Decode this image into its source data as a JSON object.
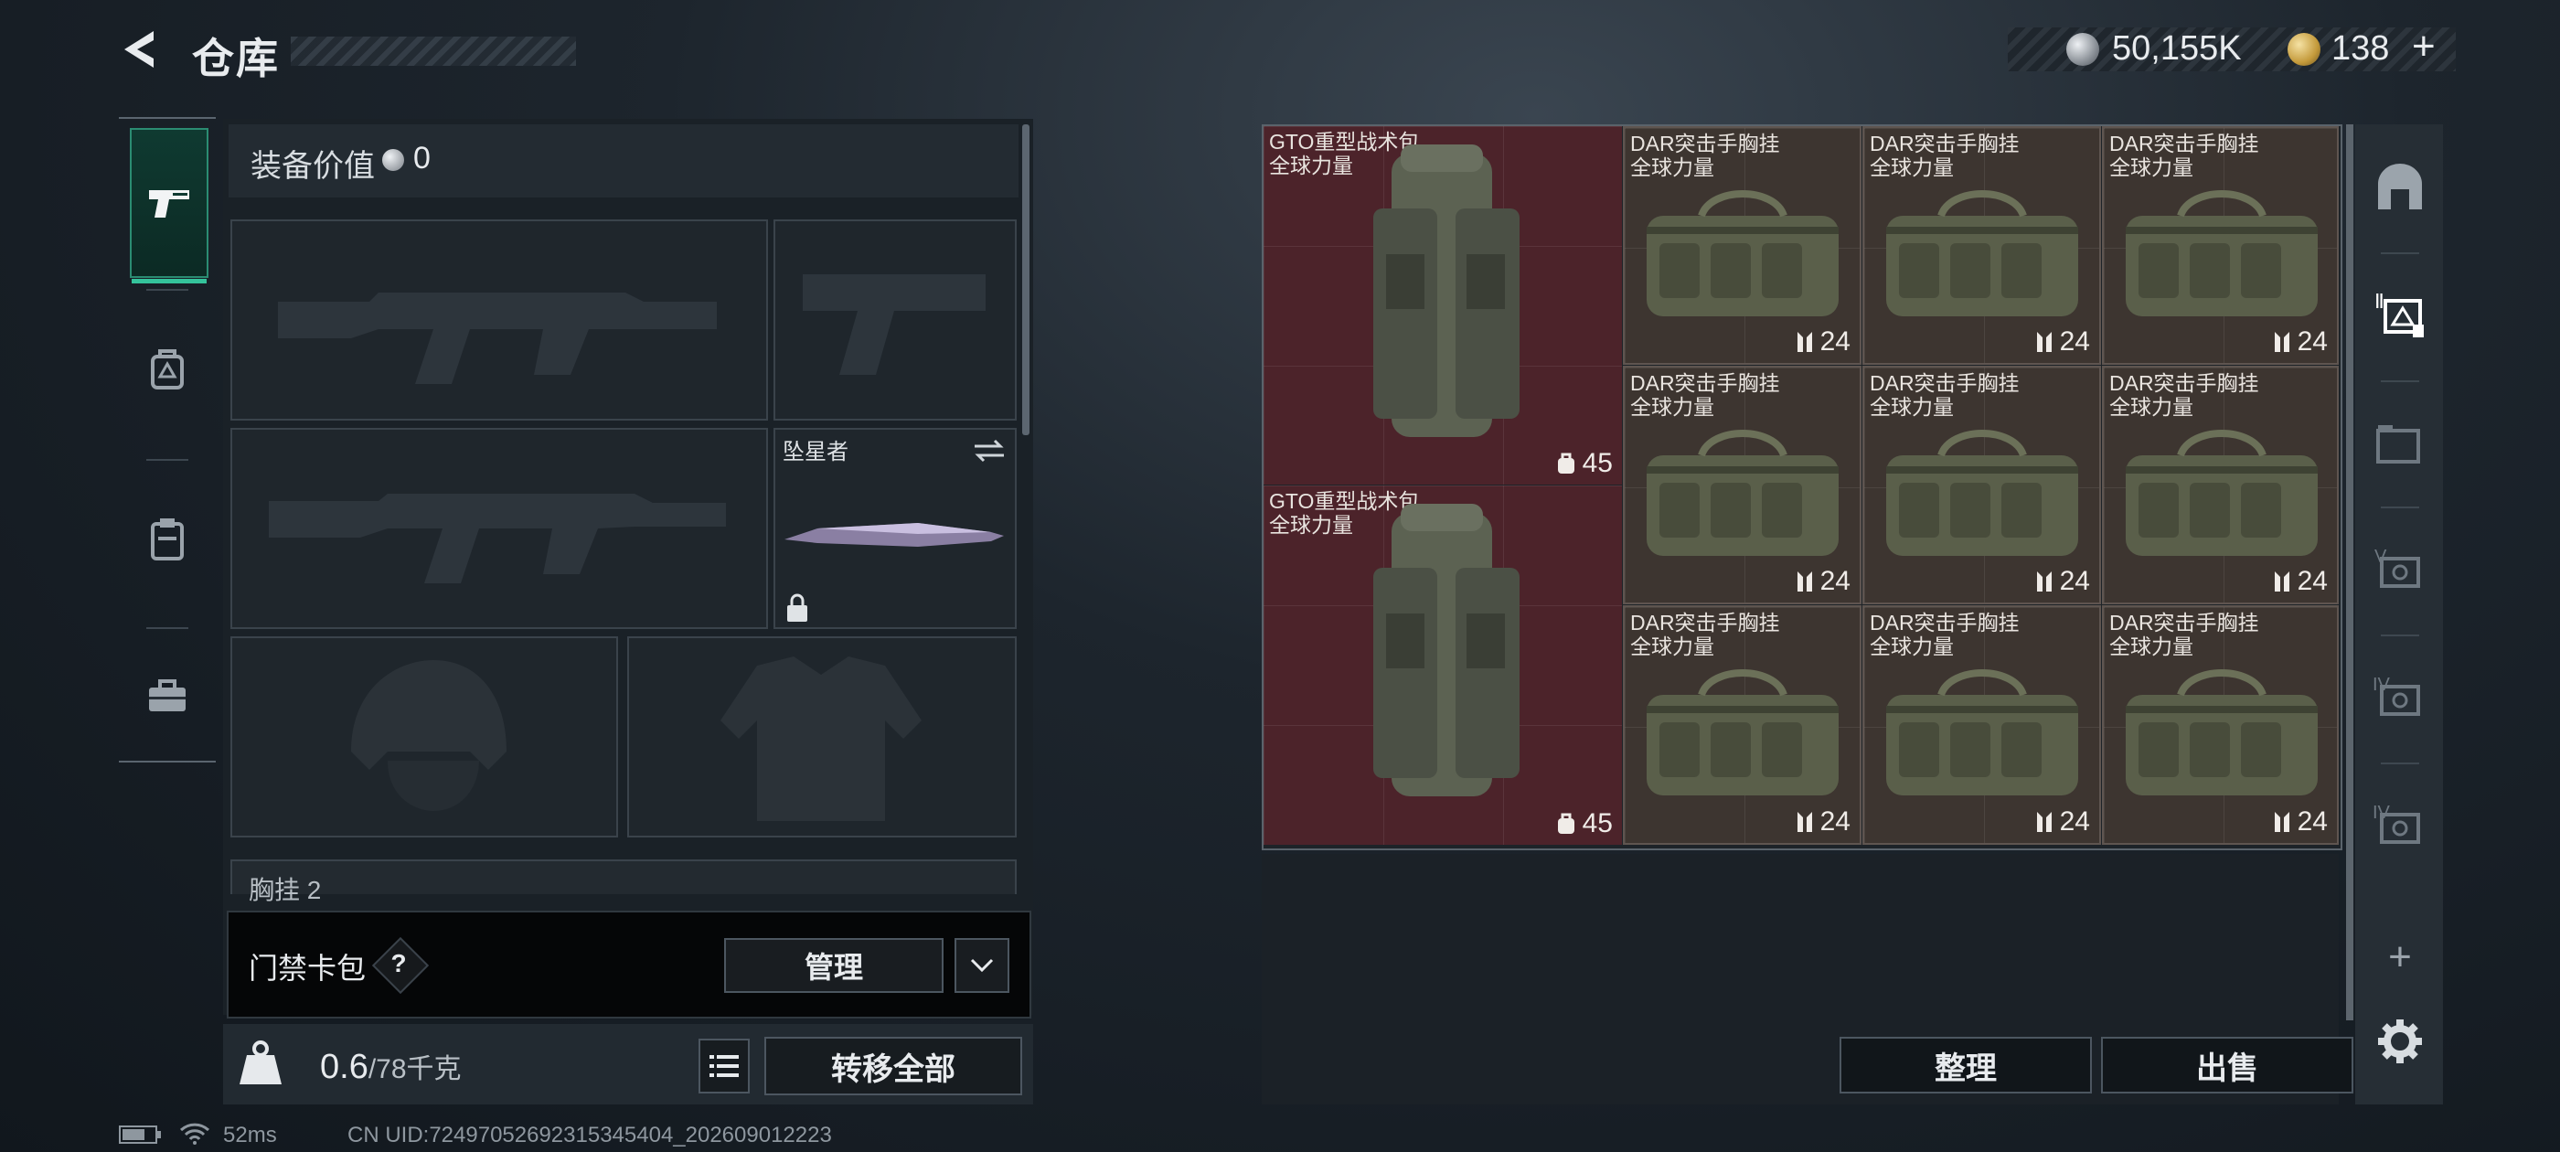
{
  "header": {
    "title": "仓库",
    "silver_amount": "50,155K",
    "gold_amount": "138",
    "gold_plus": "+"
  },
  "left_nav": {
    "tabs": [
      {
        "icon": "pistol-icon",
        "active": true
      },
      {
        "icon": "backpack-icon",
        "active": false
      },
      {
        "icon": "clipboard-icon",
        "active": false
      },
      {
        "icon": "briefcase-icon",
        "active": false
      }
    ]
  },
  "loadout": {
    "equipment_value_label": "装备价值",
    "equipment_value": "0",
    "knife_slot_name": "坠星者",
    "partial_row_label": "胸挂",
    "partial_row_count": "2",
    "access_card_label": "门禁卡包",
    "help_symbol": "?",
    "manage_label": "管理",
    "weight_current": "0.6",
    "weight_max": "/78千克",
    "transfer_all_label": "转移全部"
  },
  "storage": {
    "gto_items": [
      {
        "name_line1": "GTO重型战术包",
        "name_line2": "全球力量",
        "count": "45"
      },
      {
        "name_line1": "GTO重型战术包",
        "name_line2": "全球力量",
        "count": "45"
      }
    ],
    "dar_items": [
      {
        "name_line1": "DAR突击手胸挂",
        "name_line2": "全球力量",
        "count": "24"
      },
      {
        "name_line1": "DAR突击手胸挂",
        "name_line2": "全球力量",
        "count": "24"
      },
      {
        "name_line1": "DAR突击手胸挂",
        "name_line2": "全球力量",
        "count": "24"
      },
      {
        "name_line1": "DAR突击手胸挂",
        "name_line2": "全球力量",
        "count": "24"
      },
      {
        "name_line1": "DAR突击手胸挂",
        "name_line2": "全球力量",
        "count": "24"
      },
      {
        "name_line1": "DAR突击手胸挂",
        "name_line2": "全球力量",
        "count": "24"
      },
      {
        "name_line1": "DAR突击手胸挂",
        "name_line2": "全球力量",
        "count": "24"
      },
      {
        "name_line1": "DAR突击手胸挂",
        "name_line2": "全球力量",
        "count": "24"
      },
      {
        "name_line1": "DAR突击手胸挂",
        "name_line2": "全球力量",
        "count": "24"
      }
    ],
    "sort_label": "整理",
    "sell_label": "出售"
  },
  "right_rail": {
    "tab_labels": [
      "",
      "Ⅱ",
      "",
      "V",
      "IV",
      "IV"
    ],
    "add_symbol": "+"
  },
  "status": {
    "latency": "52ms",
    "uid": "CN UID:72497052692315345404_202609012223"
  },
  "colors": {
    "accent_green": "#34c39b",
    "backpack_bg": "#4c232a",
    "rig_bg": "#3d3530"
  }
}
